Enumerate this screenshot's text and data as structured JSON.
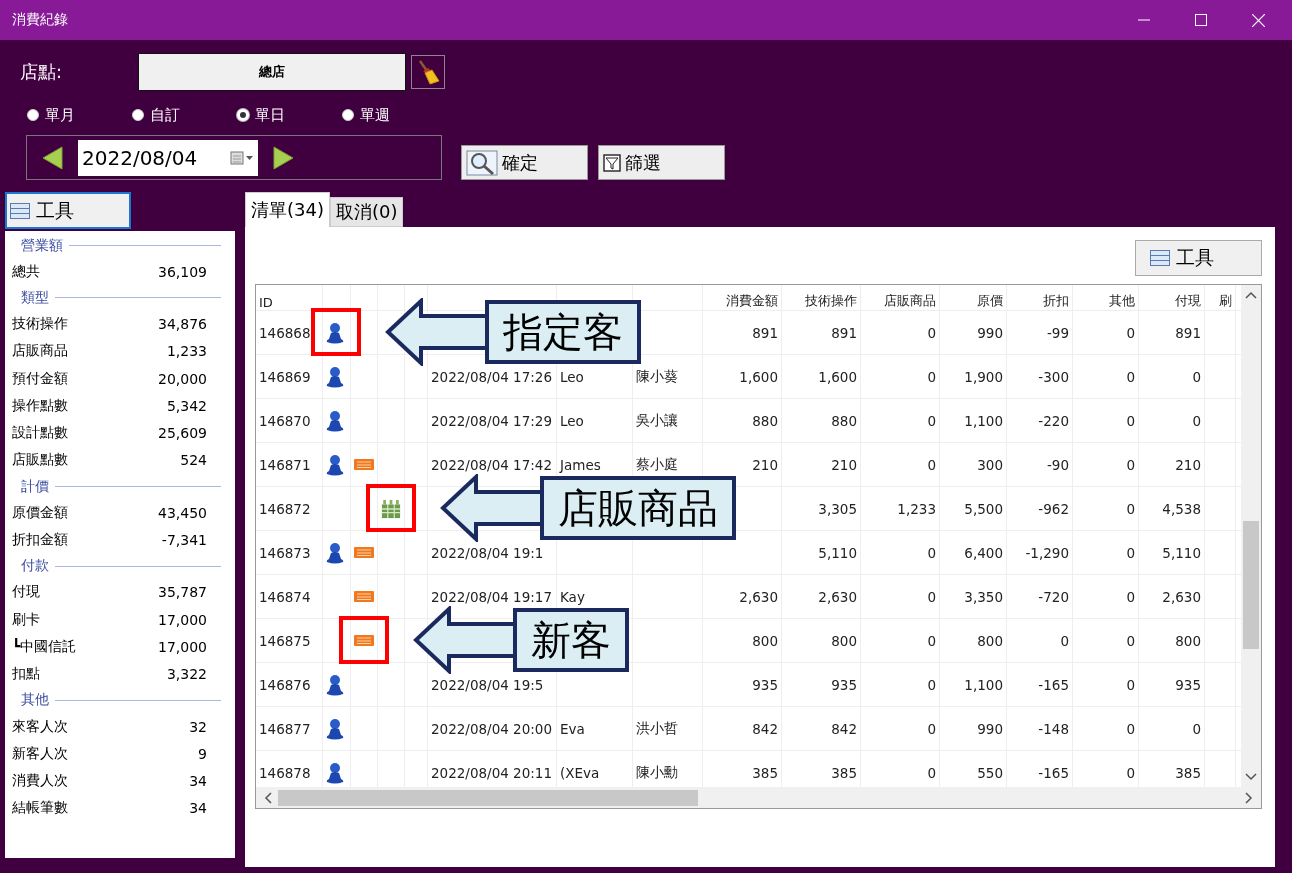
{
  "window": {
    "title": "消費紀錄"
  },
  "store": {
    "label": "店點:",
    "value": "總店"
  },
  "period_options": [
    {
      "label": "單月",
      "selected": false
    },
    {
      "label": "自訂",
      "selected": false
    },
    {
      "label": "單日",
      "selected": true
    },
    {
      "label": "單週",
      "selected": false
    }
  ],
  "date": {
    "value": "2022/08/04"
  },
  "buttons": [
    {
      "label": "確定",
      "kind": "search"
    },
    {
      "label": "篩選",
      "kind": "filter"
    }
  ],
  "sidebar": {
    "tool_button": "工具",
    "sections": [
      {
        "title": "營業額",
        "items": [
          {
            "label": "總共",
            "value": "36,109"
          }
        ]
      },
      {
        "title": "類型",
        "items": [
          {
            "label": "技術操作",
            "value": "34,876"
          },
          {
            "label": "店販商品",
            "value": "1,233"
          },
          {
            "label": "預付金額",
            "value": "20,000"
          },
          {
            "label": "操作點數",
            "value": "5,342"
          },
          {
            "label": "設計點數",
            "value": "25,609"
          },
          {
            "label": "店販點數",
            "value": "524"
          }
        ]
      },
      {
        "title": "計價",
        "items": [
          {
            "label": "原價金額",
            "value": "43,450"
          },
          {
            "label": "折扣金額",
            "value": "-7,341"
          }
        ]
      },
      {
        "title": "付款",
        "items": [
          {
            "label": "付現",
            "value": "35,787"
          },
          {
            "label": "刷卡",
            "value": "17,000"
          },
          {
            "label": "┗中國信託",
            "value": "17,000"
          },
          {
            "label": "扣點",
            "value": "3,322"
          }
        ]
      },
      {
        "title": "其他",
        "items": [
          {
            "label": "來客人次",
            "value": "32"
          },
          {
            "label": "新客人次",
            "value": "9"
          },
          {
            "label": "消費人次",
            "value": "34"
          },
          {
            "label": "結帳筆數",
            "value": "34"
          }
        ]
      }
    ]
  },
  "tabs": [
    {
      "label": "清單(34)",
      "selected": true
    },
    {
      "label": "取消(0)",
      "selected": false
    }
  ],
  "tool_button": "工具",
  "table": {
    "columns": [
      {
        "label": "ID",
        "kind": "text"
      },
      {
        "kind": "icon"
      },
      {
        "kind": "icon"
      },
      {
        "kind": "icon"
      },
      {
        "kind": "text"
      },
      {
        "kind": "text"
      },
      {
        "kind": "text"
      },
      {
        "kind": "text"
      },
      {
        "label": "消費金額",
        "kind": "number"
      },
      {
        "label": "技術操作",
        "kind": "number"
      },
      {
        "label": "店販商品",
        "kind": "number"
      },
      {
        "label": "原價",
        "kind": "number"
      },
      {
        "label": "折扣",
        "kind": "number"
      },
      {
        "label": "其他",
        "kind": "number"
      },
      {
        "label": "付現",
        "kind": "number"
      },
      {
        "label": "刷",
        "kind": "number"
      }
    ],
    "rows": [
      {
        "id": "146868",
        "designated": true,
        "new": false,
        "product": false,
        "amount": "891",
        "tech": "891",
        "retail": "0",
        "original": "990",
        "discount": "-99",
        "other": "0",
        "cash": "891"
      },
      {
        "id": "146869",
        "designated": true,
        "new": false,
        "product": false,
        "time": "2022/08/04 17:26",
        "staff": "Leo",
        "customer": "陳小葵",
        "amount": "1,600",
        "tech": "1,600",
        "retail": "0",
        "original": "1,900",
        "discount": "-300",
        "other": "0",
        "cash": "0"
      },
      {
        "id": "146870",
        "designated": true,
        "new": false,
        "product": false,
        "time": "2022/08/04 17:29",
        "staff": "Leo",
        "customer": "吳小讓",
        "amount": "880",
        "tech": "880",
        "retail": "0",
        "original": "1,100",
        "discount": "-220",
        "other": "0",
        "cash": "0"
      },
      {
        "id": "146871",
        "designated": true,
        "new": true,
        "product": false,
        "time": "2022/08/04 17:42",
        "staff": "James",
        "customer": "蔡小庭",
        "amount": "210",
        "tech": "210",
        "retail": "0",
        "original": "300",
        "discount": "-90",
        "other": "0",
        "cash": "210"
      },
      {
        "id": "146872",
        "designated": false,
        "new": false,
        "product": true,
        "tech": "3,305",
        "retail": "1,233",
        "original": "5,500",
        "discount": "-962",
        "other": "0",
        "cash": "4,538"
      },
      {
        "id": "146873",
        "designated": true,
        "new": true,
        "product": false,
        "time": "2022/08/04 19:1",
        "tech": "5,110",
        "retail": "0",
        "original": "6,400",
        "discount": "-1,290",
        "other": "0",
        "cash": "5,110"
      },
      {
        "id": "146874",
        "designated": false,
        "new": true,
        "product": false,
        "time": "2022/08/04 19:17",
        "staff": "Kay",
        "amount": "2,630",
        "tech": "2,630",
        "retail": "0",
        "original": "3,350",
        "discount": "-720",
        "other": "0",
        "cash": "2,630"
      },
      {
        "id": "146875",
        "designated": false,
        "new": true,
        "product": false,
        "amount": "800",
        "tech": "800",
        "retail": "0",
        "original": "800",
        "discount": "0",
        "other": "0",
        "cash": "800"
      },
      {
        "id": "146876",
        "designated": true,
        "new": false,
        "product": false,
        "time": "2022/08/04 19:5",
        "amount": "935",
        "tech": "935",
        "retail": "0",
        "original": "1,100",
        "discount": "-165",
        "other": "0",
        "cash": "935"
      },
      {
        "id": "146877",
        "designated": true,
        "new": false,
        "product": false,
        "time": "2022/08/04 20:00",
        "staff": "Eva",
        "customer": "洪小哲",
        "amount": "842",
        "tech": "842",
        "retail": "0",
        "original": "990",
        "discount": "-148",
        "other": "0",
        "cash": "0"
      },
      {
        "id": "146878",
        "designated": true,
        "new": false,
        "product": false,
        "time": "2022/08/04 20:11",
        "staff": "(XEva",
        "customer": "陳小勳",
        "amount": "385",
        "tech": "385",
        "retail": "0",
        "original": "550",
        "discount": "-165",
        "other": "0",
        "cash": "385"
      }
    ]
  },
  "callouts": [
    {
      "text": "指定客"
    },
    {
      "text": "店販商品"
    },
    {
      "text": "新客"
    }
  ]
}
